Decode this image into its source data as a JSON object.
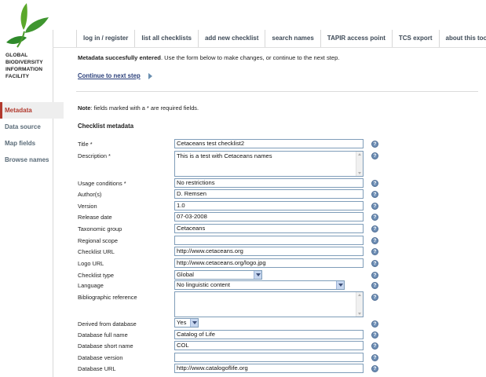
{
  "logo": {
    "lines": [
      "GLOBAL",
      "BIODIVERSITY",
      "INFORMATION",
      "FACILITY"
    ]
  },
  "topnav": [
    "log in / register",
    "list all checklists",
    "add new checklist",
    "search names",
    "TAPIR access point",
    "TCS export",
    "about this tool"
  ],
  "leftnav": [
    {
      "label": "Metadata",
      "active": true
    },
    {
      "label": "Data source",
      "active": false
    },
    {
      "label": "Map fields",
      "active": false
    },
    {
      "label": "Browse names",
      "active": false
    }
  ],
  "message": {
    "bold": "Metadata succesfully entered",
    "rest": ". Use the form below to make changes, or continue to the next step."
  },
  "continue_link": "Continue to next step",
  "note": {
    "bold": "Note",
    "rest": ": fields marked with a * are required fields."
  },
  "section_title": "Checklist metadata",
  "help_glyph": "?",
  "fields": {
    "title": {
      "label": "Title *",
      "value": "Cetaceans test checklist2"
    },
    "description": {
      "label": "Description *",
      "value": "This is a test with Cetaceans names"
    },
    "usage": {
      "label": "Usage conditions *",
      "value": "No restrictions"
    },
    "authors": {
      "label": "Author(s)",
      "value": "D. Remsen"
    },
    "version": {
      "label": "Version",
      "value": "1.0"
    },
    "release_date": {
      "label": "Release date",
      "value": "07-03-2008"
    },
    "taxonomic_group": {
      "label": "Taxonomic group",
      "value": "Cetaceans"
    },
    "regional_scope": {
      "label": "Regional scope",
      "value": ""
    },
    "checklist_url": {
      "label": "Checklist URL",
      "value": "http://www.cetaceans.org"
    },
    "logo_url": {
      "label": "Logo URL",
      "value": "http://www.cetaceans.org/logo.jpg"
    },
    "checklist_type": {
      "label": "Checklist type",
      "value": "Global"
    },
    "language": {
      "label": "Language",
      "value": "No linguistic content"
    },
    "bibliographic": {
      "label": "Bibliographic reference",
      "value": ""
    },
    "derived_from_db": {
      "label": "Derived from database",
      "value": "Yes"
    },
    "db_full_name": {
      "label": "Database full name",
      "value": "Catalog of Life"
    },
    "db_short_name": {
      "label": "Database short name",
      "value": "COL"
    },
    "db_version": {
      "label": "Database version",
      "value": ""
    },
    "db_url": {
      "label": "Database URL",
      "value": "http://www.catalogoflife.org"
    }
  },
  "colors": {
    "accent_red": "#b23a2e",
    "link_blue": "#2a3f7a",
    "logo_green": "#3a9a2a"
  }
}
